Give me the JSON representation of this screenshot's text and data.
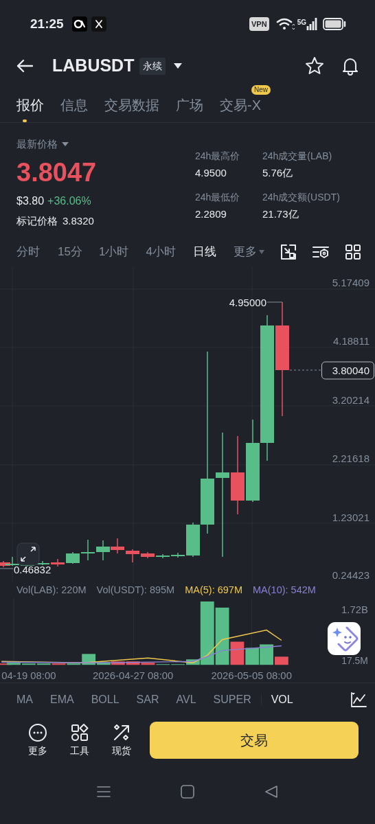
{
  "status_bar": {
    "time": "21:25",
    "vpn": "VPN",
    "network": "5G"
  },
  "header": {
    "symbol": "LABUSDT",
    "contract_type": "永续"
  },
  "tabs": [
    {
      "label": "报价",
      "selected": true
    },
    {
      "label": "信息",
      "selected": false
    },
    {
      "label": "交易数据",
      "selected": false
    },
    {
      "label": "广场",
      "selected": false
    },
    {
      "label": "交易-X",
      "selected": false,
      "badge": "New"
    }
  ],
  "price": {
    "label": "最新价格",
    "last": "3.8047",
    "usd": "$3.80",
    "change": "+36.06%",
    "mark_label": "标记价格",
    "mark": "3.8320"
  },
  "stats": [
    {
      "label": "24h最高价",
      "value": "4.9500"
    },
    {
      "label": "24h成交量(LAB)",
      "value": "5.76亿"
    },
    {
      "label": "24h最低价",
      "value": "2.2809"
    },
    {
      "label": "24h成交额(USDT)",
      "value": "21.73亿"
    }
  ],
  "intervals": [
    {
      "label": "分时",
      "selected": false,
      "kind": "plain"
    },
    {
      "label": "15分",
      "selected": false,
      "kind": "plain"
    },
    {
      "label": "1小时",
      "selected": false,
      "kind": "plain"
    },
    {
      "label": "4小时",
      "selected": false,
      "kind": "plain"
    },
    {
      "label": "日线",
      "selected": true,
      "kind": "plain"
    },
    {
      "label": "更多",
      "selected": false,
      "kind": "dropdown"
    }
  ],
  "price_chart": {
    "axis_labels": [
      "5.17409",
      "4.18811",
      "3.20214",
      "2.21618",
      "1.23021",
      "0.24423"
    ],
    "high_label": "4.95000",
    "low_label": "0.46832",
    "last_price": "3.80040"
  },
  "volume": {
    "legend": [
      {
        "label": "Vol(LAB): 220M",
        "color": "#848e9c"
      },
      {
        "label": "Vol(USDT): 895M",
        "color": "#848e9c"
      },
      {
        "label": "MA(5): 697M",
        "color": "#f0c94b"
      },
      {
        "label": "MA(10): 542M",
        "color": "#8a80d6"
      }
    ],
    "axis_labels": [
      "1.72B",
      "17.5M"
    ],
    "dates": [
      "04-19 08:00",
      "2026-04-27 08:00",
      "2026-05-05 08:00"
    ]
  },
  "indicators": [
    {
      "label": "MA",
      "selected": false
    },
    {
      "label": "EMA",
      "selected": false
    },
    {
      "label": "BOLL",
      "selected": false
    },
    {
      "label": "SAR",
      "selected": false
    },
    {
      "label": "AVL",
      "selected": false
    },
    {
      "label": "SUPER",
      "selected": false
    },
    {
      "label": "VOL",
      "selected": true
    }
  ],
  "actions": [
    {
      "label": "更多"
    },
    {
      "label": "工具"
    },
    {
      "label": "现货"
    }
  ],
  "trade_button": "交易"
}
